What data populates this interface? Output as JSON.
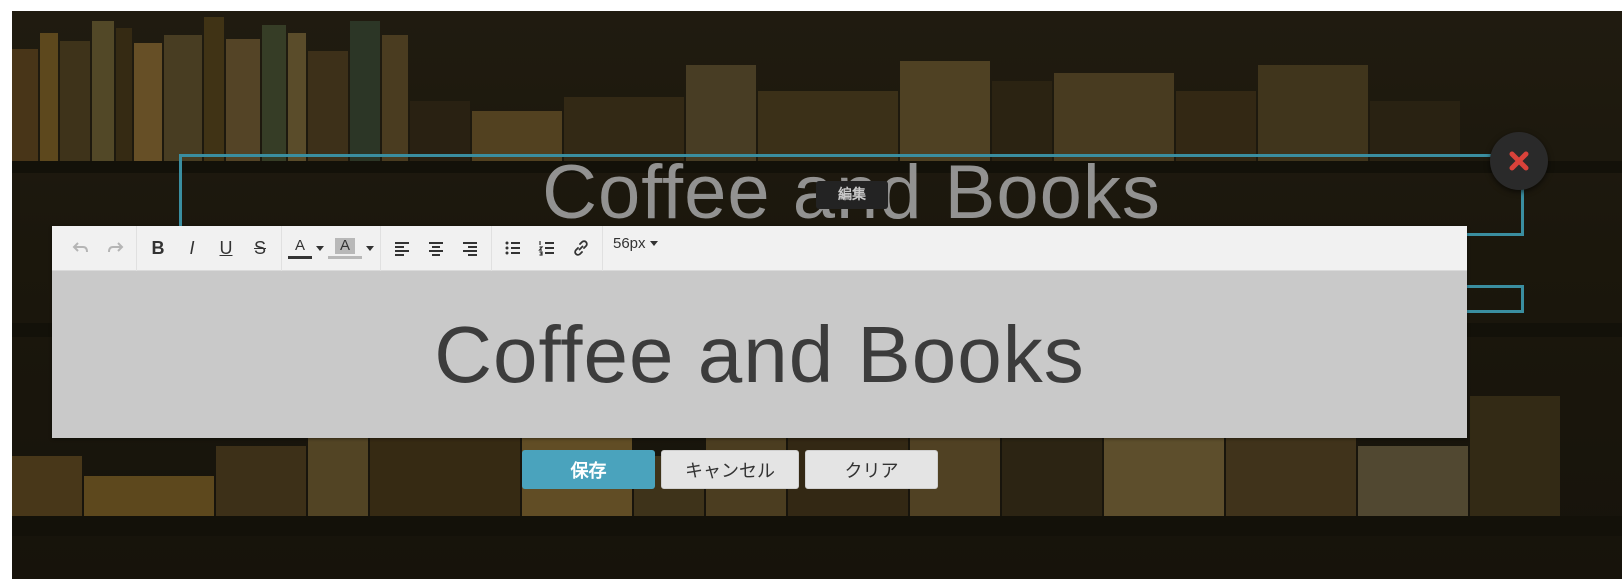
{
  "page": {
    "heading": "Coffee and Books",
    "edit_badge": "編集"
  },
  "toolbar": {
    "undo": "undo-icon",
    "redo": "redo-icon",
    "bold": "B",
    "italic": "I",
    "underline": "U",
    "strikethrough": "S",
    "font_color": "A",
    "highlight_color": "A",
    "font_size": "56px"
  },
  "editor": {
    "content": "Coffee and Books"
  },
  "actions": {
    "save": "保存",
    "cancel": "キャンセル",
    "clear": "クリア"
  },
  "colors": {
    "accent": "#4aa3bd",
    "frame": "#3a8ea0",
    "close": "#d9423a"
  }
}
